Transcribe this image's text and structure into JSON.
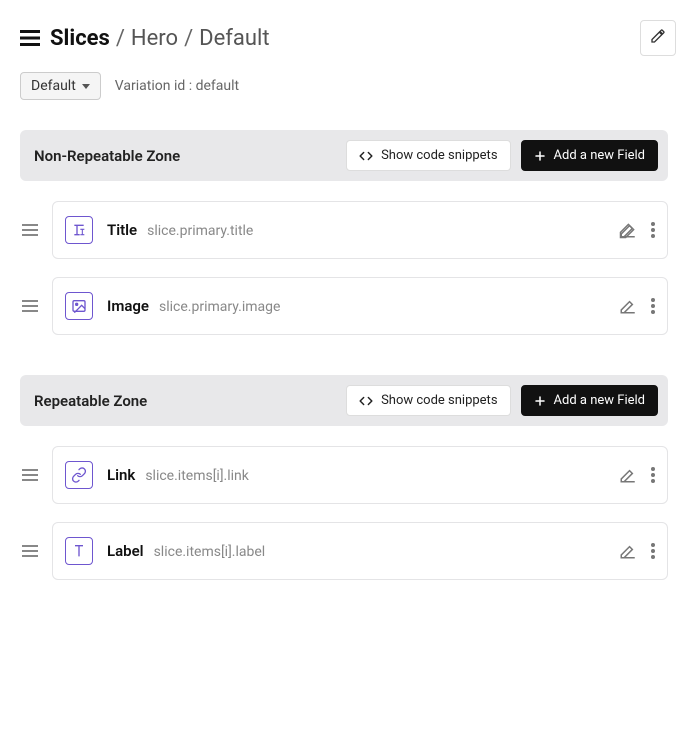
{
  "header": {
    "breadcrumb": {
      "root": "Slices",
      "path1": "Hero",
      "path2": "Default"
    }
  },
  "variation": {
    "selected": "Default",
    "idLabel": "Variation id : default"
  },
  "zones": [
    {
      "title": "Non-Repeatable Zone",
      "showSnippets": "Show code snippets",
      "addField": "Add a new Field",
      "fields": [
        {
          "icon": "text",
          "name": "Title",
          "path": "slice.primary.title"
        },
        {
          "icon": "image",
          "name": "Image",
          "path": "slice.primary.image"
        }
      ]
    },
    {
      "title": "Repeatable Zone",
      "showSnippets": "Show code snippets",
      "addField": "Add a new Field",
      "fields": [
        {
          "icon": "link",
          "name": "Link",
          "path": "slice.items[i].link"
        },
        {
          "icon": "label",
          "name": "Label",
          "path": "slice.items[i].label"
        }
      ]
    }
  ]
}
